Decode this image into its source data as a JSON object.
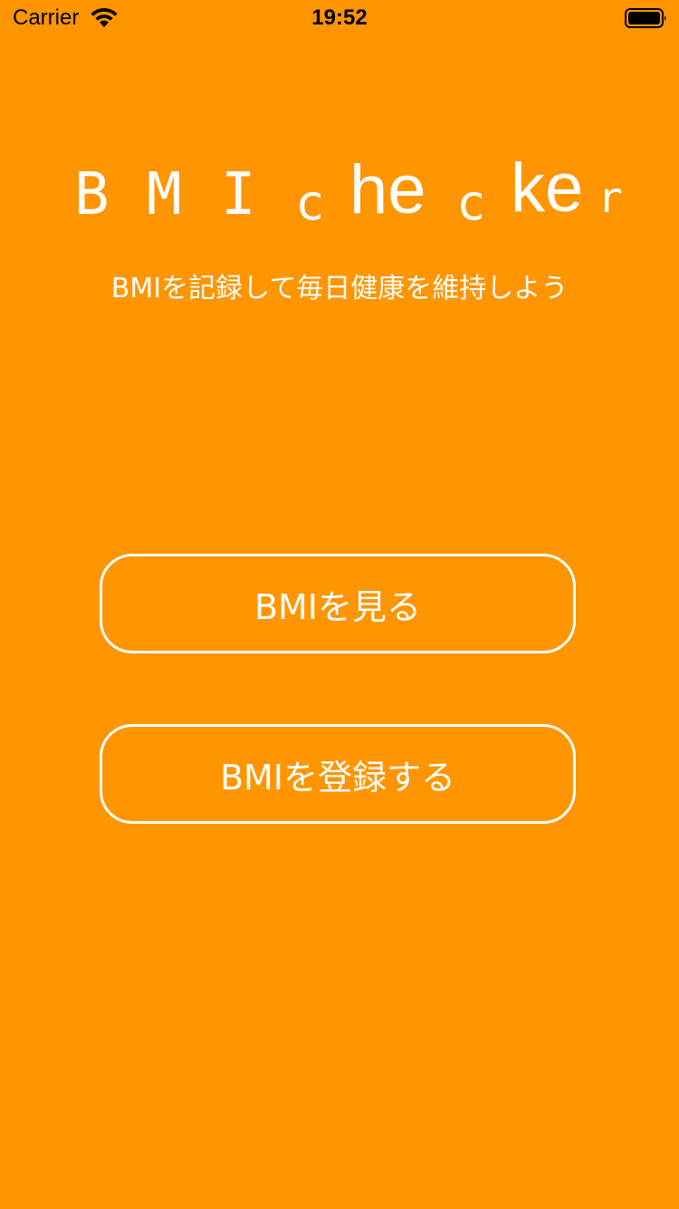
{
  "status_bar": {
    "carrier": "Carrier",
    "time": "19:52",
    "wifi_icon": "wifi-icon",
    "battery_icon": "battery-icon"
  },
  "title": {
    "text": "BMIchecker",
    "parts": [
      "B",
      "M",
      "I",
      "c",
      "he",
      "c",
      "ke",
      "r"
    ]
  },
  "subtitle": "BMIを記録して毎日健康を維持しよう",
  "buttons": {
    "view_label": "BMIを見る",
    "register_label": "BMIを登録する"
  },
  "colors": {
    "background": "#FF9500",
    "foreground": "#FFFFFF"
  }
}
